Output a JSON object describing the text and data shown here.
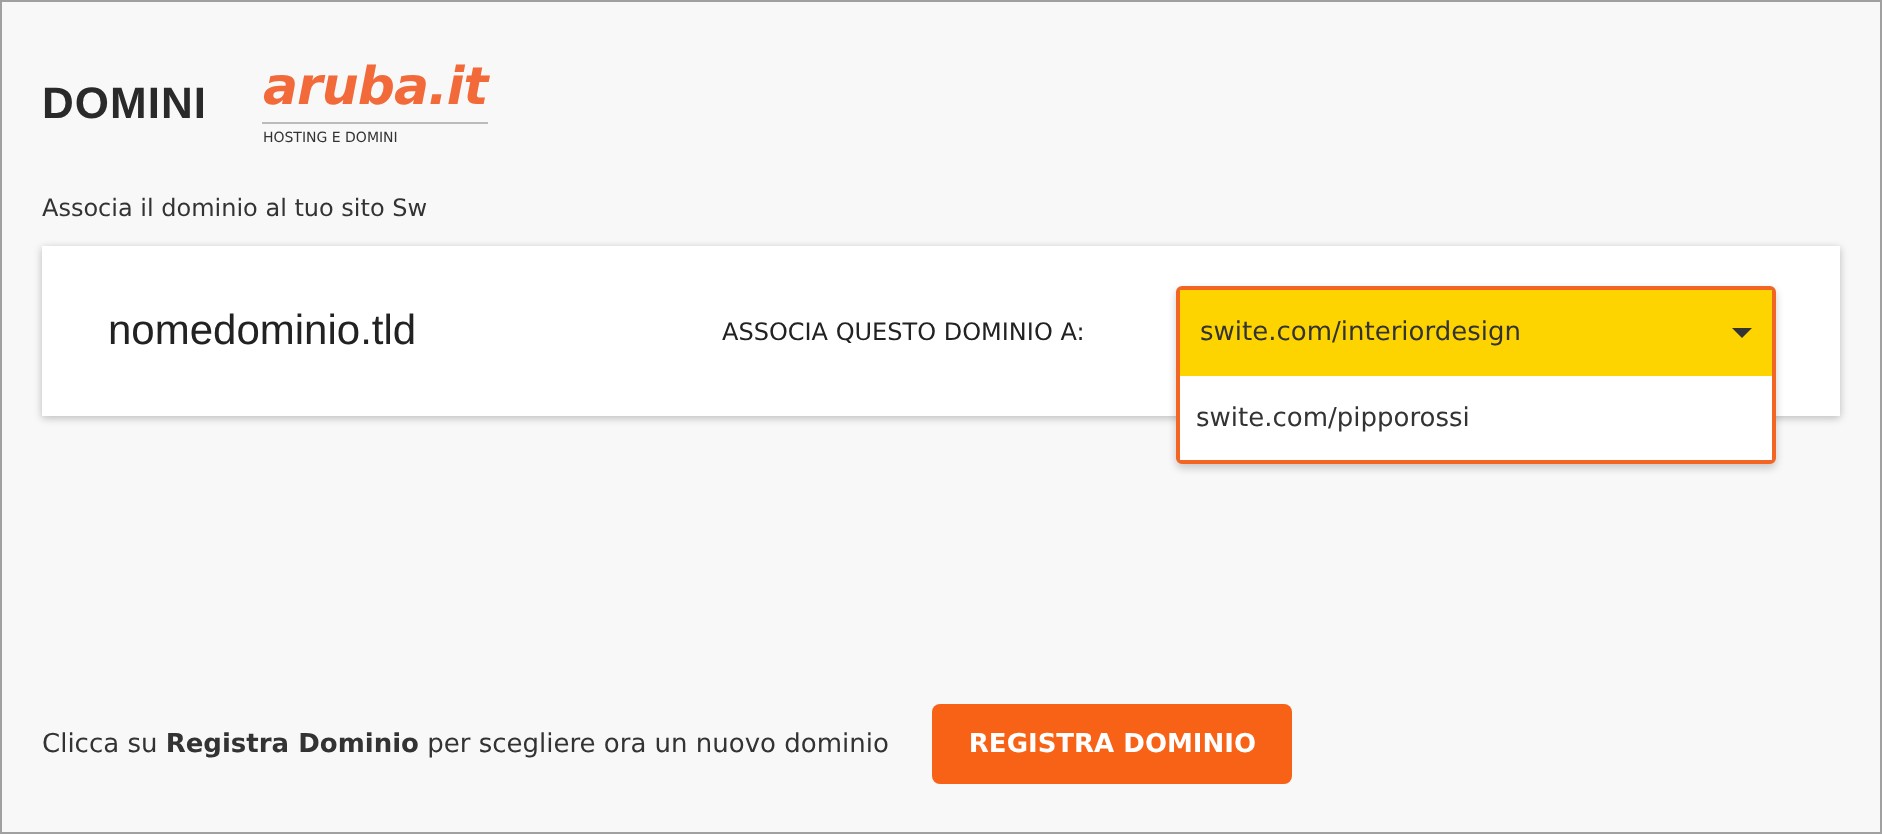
{
  "header": {
    "title": "DOMINI",
    "logo": {
      "wordmark": "aruba.it",
      "tagline": "HOSTING E DOMINI"
    }
  },
  "intro": "Associa il dominio al tuo sito Sw",
  "domain_card": {
    "domain": "nomedominio.tld",
    "label": "ASSOCIA QUESTO DOMINIO A:",
    "dropdown": {
      "value": "swite.com/interiordesign",
      "expanded": true,
      "options": [
        {
          "label": "swite.com/pipporossi",
          "selected": false
        }
      ]
    }
  },
  "footer": {
    "text": "Clicca su **Registra Dominio** per scegliere ora un nuovo dominio",
    "button": "REGISTRA DOMINIO"
  }
}
